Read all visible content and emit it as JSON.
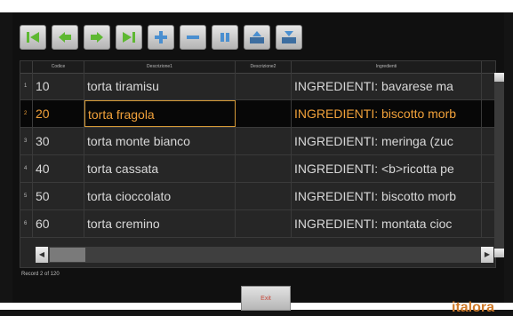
{
  "table": {
    "headers": [
      "Codice",
      "Descrizione1",
      "Descrizione2",
      "Ingredienti"
    ],
    "rows": [
      {
        "num": "1",
        "codice": "10",
        "desc1": "torta tiramisu",
        "desc2": "",
        "ingr": "INGREDIENTI: bavarese ma"
      },
      {
        "num": "2",
        "codice": "20",
        "desc1": "torta fragola",
        "desc2": "",
        "ingr": "INGREDIENTI: biscotto morb"
      },
      {
        "num": "3",
        "codice": "30",
        "desc1": "torta monte bianco",
        "desc2": "",
        "ingr": "INGREDIENTI: meringa (zuc"
      },
      {
        "num": "4",
        "codice": "40",
        "desc1": "torta cassata",
        "desc2": "",
        "ingr": "INGREDIENTI: <b>ricotta pe"
      },
      {
        "num": "5",
        "codice": "50",
        "desc1": "torta cioccolato",
        "desc2": "",
        "ingr": "INGREDIENTI: biscotto morb"
      },
      {
        "num": "6",
        "codice": "60",
        "desc1": "torta cremino",
        "desc2": "",
        "ingr": "INGREDIENTI: montata cioc"
      }
    ]
  },
  "record_label": "Record 2 of 120",
  "exit_label": "Exit",
  "brand": "italora",
  "colors": {
    "selected_text": "#f1a13a",
    "brand": "#d07b2a"
  }
}
